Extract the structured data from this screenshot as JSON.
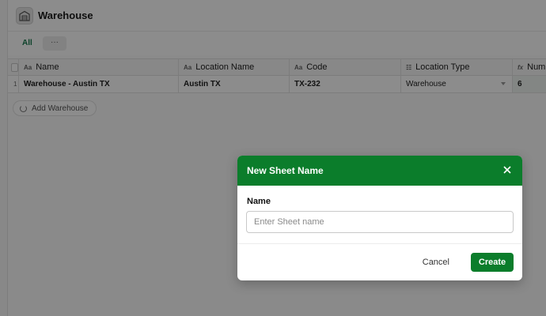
{
  "app": {
    "title": "Warehouse",
    "icon": "warehouse-icon"
  },
  "tabs": {
    "all_label": "All",
    "more_label": "···"
  },
  "grid": {
    "columns": [
      {
        "type_icon": "Aa",
        "label": "Name"
      },
      {
        "type_icon": "Aa",
        "label": "Location Name"
      },
      {
        "type_icon": "Aa",
        "label": "Code"
      },
      {
        "type_icon": "☷",
        "label": "Location Type"
      },
      {
        "type_icon": "fx",
        "label": "Num"
      }
    ],
    "rows": [
      {
        "index": "1",
        "name": "Warehouse - Austin TX",
        "location_name": "Austin TX",
        "code": "TX-232",
        "location_type": "Warehouse",
        "num": "6"
      }
    ],
    "add_button_label": "Add Warehouse"
  },
  "modal": {
    "title": "New Sheet Name",
    "field_label": "Name",
    "field_placeholder": "Enter Sheet name",
    "field_value": "",
    "cancel_label": "Cancel",
    "create_label": "Create"
  },
  "colors": {
    "accent": "#0b7d2b",
    "tab_active": "#18794e",
    "overlay": "rgba(0,0,0,0.45)"
  }
}
